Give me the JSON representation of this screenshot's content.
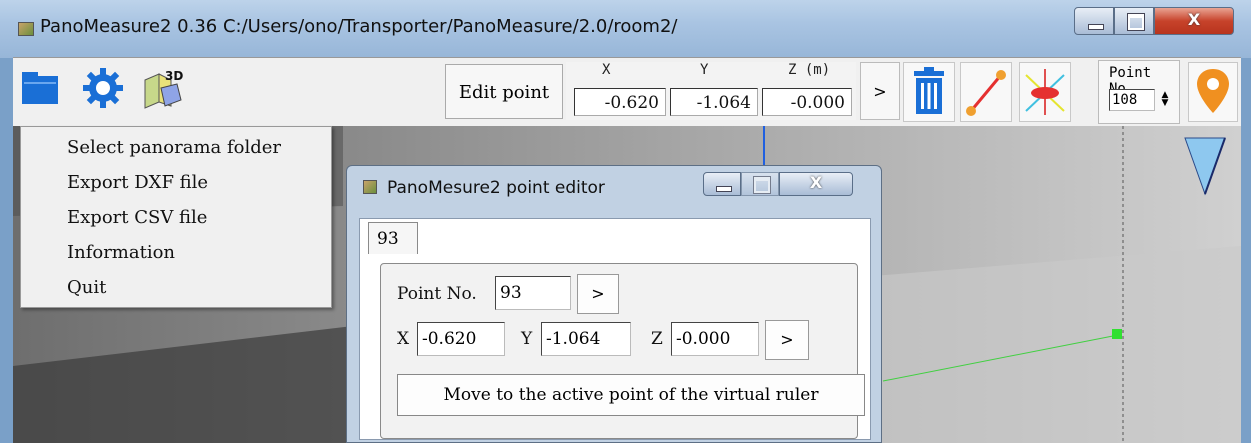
{
  "window": {
    "title": "PanoMeasure2 0.36  C:/Users/ono/Transporter/PanoMeasure/2.0/room2/",
    "close_glyph": "X"
  },
  "toolbar": {
    "edit_label": "Edit point",
    "coords": {
      "x_header": "X",
      "y_header": "Y",
      "z_header": "Z (m)",
      "x_value": "-0.620",
      "y_value": "-1.064",
      "z_value": "-0.000"
    },
    "go_label": ">",
    "point_no_label": "Point No.",
    "point_no_value": "108",
    "icons": [
      "folder-icon",
      "gear-icon",
      "cube-3d-icon",
      "trash-icon",
      "ruler-line-icon",
      "horizon-target-icon",
      "location-marker-icon"
    ],
    "cube_text": "3D",
    "accent": "#1a6fd6"
  },
  "menu": {
    "items": [
      {
        "label": "Select panorama folder"
      },
      {
        "label": "Export DXF file"
      },
      {
        "label": "Export CSV file"
      },
      {
        "label": "Information"
      },
      {
        "label": "Quit"
      }
    ]
  },
  "dialog": {
    "title": "PanoMesure2 point editor",
    "tab_label": "93",
    "close_glyph": "X",
    "point_no_label": "Point No.",
    "point_no_value": "93",
    "go_label": ">",
    "x_label": "X",
    "x_value": "-0.620",
    "y_label": "Y",
    "y_value": "-1.064",
    "z_label": "Z",
    "z_value": "-0.000",
    "coord_go_label": ">",
    "move_button_label": "Move to the active point of the virtual ruler"
  }
}
